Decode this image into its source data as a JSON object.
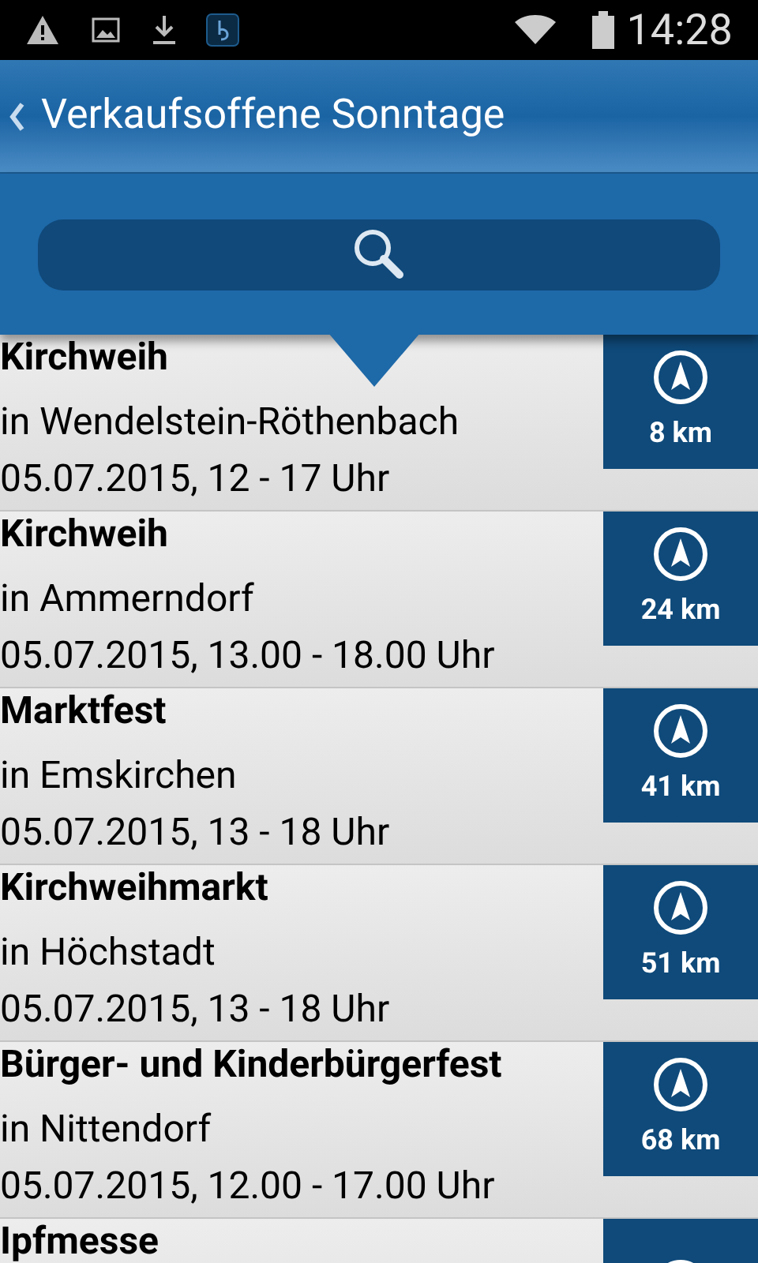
{
  "status_bar": {
    "time": "14:28"
  },
  "header": {
    "title": "Verkaufsoffene Sonntage"
  },
  "events": [
    {
      "title": "Kirchweih",
      "place": "in Wendelstein-Röthenbach",
      "date": "05.07.2015, 12 - 17 Uhr",
      "distance": "8 km"
    },
    {
      "title": "Kirchweih",
      "place": "in Ammerndorf",
      "date": "05.07.2015, 13.00 - 18.00 Uhr",
      "distance": "24 km"
    },
    {
      "title": "Marktfest",
      "place": "in Emskirchen",
      "date": "05.07.2015, 13 - 18 Uhr",
      "distance": "41 km"
    },
    {
      "title": "Kirchweihmarkt",
      "place": "in Höchstadt",
      "date": "05.07.2015, 13 - 18 Uhr",
      "distance": "51 km"
    },
    {
      "title": "Bürger- und Kinderbürgerfest",
      "place": "in Nittendorf",
      "date": "05.07.2015, 12.00 - 17.00 Uhr",
      "distance": "68 km"
    },
    {
      "title": "Ipfmesse"
    }
  ]
}
